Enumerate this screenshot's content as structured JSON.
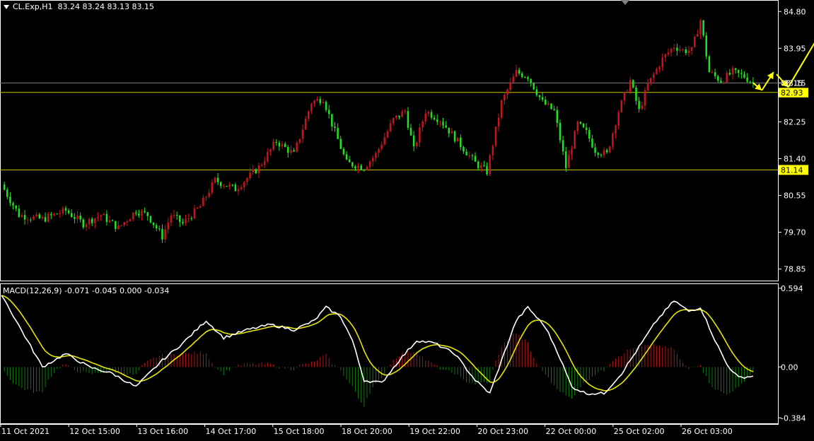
{
  "window": {
    "symbol_header": "CL.Exp,H1  83.24 83.24 83.13 83.15",
    "macd_header": "MACD(12,26,9) -0.071 -0.045 0.000 -0.034"
  },
  "colors": {
    "bull": "#c8141e",
    "bear": "#1ee61e",
    "line_level": "#c8c800",
    "price_line": "#808080",
    "macd_line": "#ffffff",
    "signal_line": "#e6e600",
    "hist_pos": "#b41414",
    "hist_neg": "#0f7a0f",
    "arrow": "#ffff00"
  },
  "chart_data": [
    {
      "type": "candlestick",
      "price_axis": [
        "84.80",
        "83.95",
        "83.15",
        "82.25",
        "81.40",
        "80.55",
        "79.70",
        "78.85"
      ],
      "ylim": [
        78.6,
        85.0
      ],
      "time_axis": [
        "11 Oct 2021",
        "12 Oct 15:00",
        "13 Oct 16:00",
        "14 Oct 17:00",
        "15 Oct 18:00",
        "18 Oct 20:00",
        "19 Oct 22:00",
        "20 Oct 23:00",
        "22 Oct 00:00",
        "25 Oct 02:00",
        "26 Oct 03:00"
      ],
      "levels": [
        {
          "value": 82.93,
          "label": "82.93"
        },
        {
          "value": 81.14,
          "label": "81.14"
        }
      ],
      "current_price": {
        "value": 83.15,
        "label": "83.15"
      },
      "keypoints": [
        [
          0,
          80.8
        ],
        [
          6,
          80.1
        ],
        [
          14,
          80.0
        ],
        [
          22,
          80.2
        ],
        [
          28,
          79.9
        ],
        [
          34,
          80.1
        ],
        [
          40,
          79.8
        ],
        [
          46,
          80.2
        ],
        [
          50,
          80.1
        ],
        [
          55,
          79.6
        ],
        [
          58,
          80.1
        ],
        [
          62,
          79.9
        ],
        [
          68,
          80.3
        ],
        [
          73,
          80.9
        ],
        [
          80,
          80.7
        ],
        [
          88,
          81.2
        ],
        [
          94,
          81.8
        ],
        [
          100,
          81.5
        ],
        [
          106,
          82.7
        ],
        [
          110,
          82.8
        ],
        [
          113,
          82.2
        ],
        [
          118,
          81.3
        ],
        [
          124,
          81.2
        ],
        [
          128,
          81.5
        ],
        [
          134,
          82.3
        ],
        [
          138,
          82.5
        ],
        [
          141,
          81.6
        ],
        [
          145,
          82.5
        ],
        [
          150,
          82.3
        ],
        [
          156,
          81.8
        ],
        [
          162,
          81.3
        ],
        [
          166,
          81.1
        ],
        [
          171,
          82.7
        ],
        [
          176,
          83.4
        ],
        [
          180,
          83.3
        ],
        [
          185,
          82.7
        ],
        [
          189,
          82.5
        ],
        [
          193,
          81.2
        ],
        [
          197,
          82.2
        ],
        [
          200,
          82.0
        ],
        [
          203,
          81.6
        ],
        [
          207,
          81.5
        ],
        [
          211,
          82.5
        ],
        [
          215,
          83.2
        ],
        [
          218,
          82.5
        ],
        [
          221,
          83.1
        ],
        [
          226,
          83.7
        ],
        [
          230,
          84.0
        ],
        [
          233,
          83.9
        ],
        [
          236,
          83.9
        ],
        [
          239,
          84.6
        ],
        [
          242,
          83.4
        ],
        [
          246,
          83.2
        ],
        [
          250,
          83.4
        ],
        [
          254,
          83.3
        ],
        [
          257,
          83.15
        ]
      ],
      "arrows": [
        {
          "from": [
            257,
            83.15
          ],
          "to": [
            260,
            82.98
          ]
        },
        {
          "from": [
            260,
            82.98
          ],
          "to": [
            264,
            83.4
          ]
        },
        {
          "from": [
            265,
            83.35
          ],
          "to": [
            269,
            83.05
          ]
        },
        {
          "from": [
            269,
            83.05
          ],
          "to": [
            280,
            84.3
          ]
        }
      ]
    },
    {
      "type": "macd",
      "axis": [
        "0.594",
        "0.00",
        "-0.384"
      ],
      "ylim": [
        -0.42,
        0.62
      ],
      "keypoints": [
        [
          0,
          0.55
        ],
        [
          5,
          0.35
        ],
        [
          14,
          0.0
        ],
        [
          22,
          0.1
        ],
        [
          30,
          0.0
        ],
        [
          38,
          -0.05
        ],
        [
          46,
          -0.15
        ],
        [
          55,
          0.05
        ],
        [
          62,
          0.18
        ],
        [
          70,
          0.35
        ],
        [
          76,
          0.22
        ],
        [
          84,
          0.28
        ],
        [
          92,
          0.32
        ],
        [
          100,
          0.28
        ],
        [
          107,
          0.35
        ],
        [
          111,
          0.45
        ],
        [
          116,
          0.38
        ],
        [
          120,
          0.2
        ],
        [
          124,
          -0.1
        ],
        [
          130,
          -0.12
        ],
        [
          136,
          0.05
        ],
        [
          142,
          0.2
        ],
        [
          148,
          0.18
        ],
        [
          155,
          0.1
        ],
        [
          162,
          -0.1
        ],
        [
          167,
          -0.2
        ],
        [
          171,
          0.05
        ],
        [
          176,
          0.35
        ],
        [
          180,
          0.45
        ],
        [
          186,
          0.3
        ],
        [
          190,
          0.12
        ],
        [
          195,
          -0.15
        ],
        [
          200,
          -0.2
        ],
        [
          206,
          -0.2
        ],
        [
          212,
          -0.05
        ],
        [
          218,
          0.15
        ],
        [
          224,
          0.35
        ],
        [
          230,
          0.5
        ],
        [
          235,
          0.42
        ],
        [
          239,
          0.45
        ],
        [
          244,
          0.2
        ],
        [
          248,
          0.02
        ],
        [
          252,
          -0.08
        ],
        [
          257,
          -0.07
        ]
      ]
    }
  ]
}
